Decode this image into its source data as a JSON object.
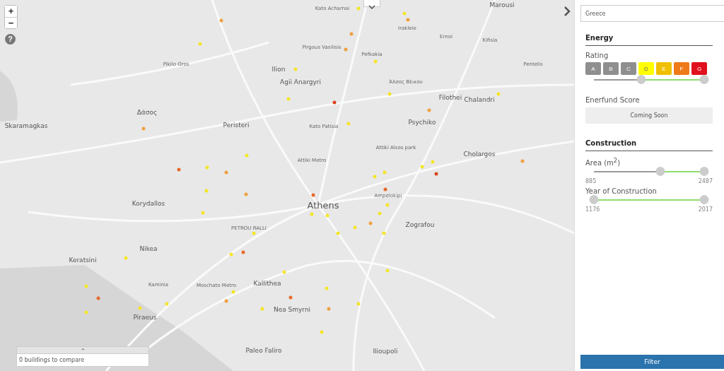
{
  "map": {
    "zoom_in": "+",
    "zoom_out": "−",
    "help": "?",
    "places": [
      {
        "name": "Kato Acharnai",
        "kind": "small"
      },
      {
        "name": "Marousi",
        "kind": "town"
      },
      {
        "name": "Irakleio",
        "kind": "small"
      },
      {
        "name": "Ernoi",
        "kind": "small"
      },
      {
        "name": "Kifisia",
        "kind": "small"
      },
      {
        "name": "Pirgous Vasilisis",
        "kind": "small"
      },
      {
        "name": "Pefkakia",
        "kind": "small"
      },
      {
        "name": "Pikilo Oros",
        "kind": "small"
      },
      {
        "name": "Ilion",
        "kind": "town"
      },
      {
        "name": "Pentelis",
        "kind": "small"
      },
      {
        "name": "Agii Anargyri",
        "kind": "town"
      },
      {
        "name": "Άλσος Βέικου",
        "kind": "small"
      },
      {
        "name": "Filothei",
        "kind": "town"
      },
      {
        "name": "Chalandri",
        "kind": "town"
      },
      {
        "name": "Δάσος",
        "kind": "town"
      },
      {
        "name": "Skaramagkas",
        "kind": "town"
      },
      {
        "name": "Peristeri",
        "kind": "town"
      },
      {
        "name": "Kato Patisia",
        "kind": "small"
      },
      {
        "name": "Psychiko",
        "kind": "town"
      },
      {
        "name": "Attiki Alsos park",
        "kind": "small"
      },
      {
        "name": "Cholargos",
        "kind": "town"
      },
      {
        "name": "Attiki Metro",
        "kind": "small"
      },
      {
        "name": "Korydallos",
        "kind": "town"
      },
      {
        "name": "Athens",
        "kind": "city"
      },
      {
        "name": "Ampelokipi",
        "kind": "small"
      },
      {
        "name": "PETROU RALLI",
        "kind": "small"
      },
      {
        "name": "Zografou",
        "kind": "town"
      },
      {
        "name": "Nikea",
        "kind": "town"
      },
      {
        "name": "Keratsini",
        "kind": "town"
      },
      {
        "name": "Kaminia",
        "kind": "small"
      },
      {
        "name": "Moschato Metro",
        "kind": "small"
      },
      {
        "name": "Kallithea",
        "kind": "town"
      },
      {
        "name": "Nea Smyrni",
        "kind": "town"
      },
      {
        "name": "Piraeus",
        "kind": "town"
      },
      {
        "name": "Paleo Faliro",
        "kind": "town"
      },
      {
        "name": "Ilioupoli",
        "kind": "town"
      }
    ],
    "buildings": [
      {
        "color": "#f0a040"
      },
      {
        "color": "#f5e52a"
      },
      {
        "color": "#f0a040"
      },
      {
        "color": "#f0a040"
      },
      {
        "color": "#f5e52a"
      },
      {
        "color": "#f0a040"
      },
      {
        "color": "#f5e52a"
      },
      {
        "color": "#f5e52a"
      },
      {
        "color": "#f5e52a"
      },
      {
        "color": "#f0a040"
      },
      {
        "color": "#d9451c"
      },
      {
        "color": "#f5e52a"
      },
      {
        "color": "#f0a040"
      },
      {
        "color": "#f5e52a"
      },
      {
        "color": "#f5e52a"
      },
      {
        "color": "#f5e52a"
      },
      {
        "color": "#f5e52a"
      },
      {
        "color": "#f5e52a"
      },
      {
        "color": "#f0a040"
      },
      {
        "color": "#e8692a"
      },
      {
        "color": "#f5e52a"
      },
      {
        "color": "#d9451c"
      },
      {
        "color": "#f5e52a"
      },
      {
        "color": "#f5e52a"
      },
      {
        "color": "#e8692a"
      },
      {
        "color": "#f5e52a"
      },
      {
        "color": "#f0a040"
      },
      {
        "color": "#e8692a"
      },
      {
        "color": "#f5e52a"
      },
      {
        "color": "#f5e52a"
      },
      {
        "color": "#f0a040"
      },
      {
        "color": "#f5e52a"
      },
      {
        "color": "#f0a040"
      },
      {
        "color": "#f5e52a"
      },
      {
        "color": "#f5e52a"
      },
      {
        "color": "#f5e52a"
      },
      {
        "color": "#f5e52a"
      },
      {
        "color": "#e8692a"
      },
      {
        "color": "#f5e52a"
      },
      {
        "color": "#f5e52a"
      },
      {
        "color": "#f5e52a"
      },
      {
        "color": "#f5e52a"
      },
      {
        "color": "#f5e52a"
      },
      {
        "color": "#f5e52a"
      },
      {
        "color": "#f5e52a"
      },
      {
        "color": "#f5e52a"
      },
      {
        "color": "#e8692a"
      },
      {
        "color": "#f5e52a"
      },
      {
        "color": "#f5e52a"
      },
      {
        "color": "#e8692a"
      },
      {
        "color": "#f0a040"
      },
      {
        "color": "#f5e52a"
      },
      {
        "color": "#f5e52a"
      },
      {
        "color": "#f5e52a"
      },
      {
        "color": "#f5e52a"
      },
      {
        "color": "#f5e52a"
      },
      {
        "color": "#f5e52a"
      },
      {
        "color": "#f0a040"
      }
    ]
  },
  "compare": {
    "toggle": "⌃",
    "text": "0 buildings to compare"
  },
  "sidebar": {
    "country": "Greece",
    "energy": {
      "title": "Energy",
      "rating_label": "Rating",
      "ratings": [
        {
          "label": "A",
          "selected": false
        },
        {
          "label": "B",
          "selected": false
        },
        {
          "label": "C",
          "selected": false
        },
        {
          "label": "D",
          "color": "#ffff00",
          "selected": true
        },
        {
          "label": "E",
          "color": "#f0c000",
          "selected": true
        },
        {
          "label": "F",
          "color": "#ee7a1a",
          "selected": true
        },
        {
          "label": "G",
          "color": "#e0101e",
          "selected": true
        }
      ],
      "rating_range": {
        "from": {
          "level": 0.43
        },
        "to": {
          "level": 1
        }
      },
      "score_label": "Enerfund Score",
      "score_value": "Coming Soon"
    },
    "construction": {
      "title": "Construction",
      "area_label": "Area (m$^{2}$)",
      "area_range": {
        "from": {
          "level": 0.6
        },
        "to": {
          "level": 1
        }
      },
      "area_min": "885",
      "area_max": "2487",
      "year_label": "Year of Construction",
      "year_range": {
        "from": {
          "level": 0
        },
        "to": {
          "level": 1
        }
      },
      "year_min": "1176",
      "year_max": "2017"
    },
    "filter": "Filter"
  }
}
